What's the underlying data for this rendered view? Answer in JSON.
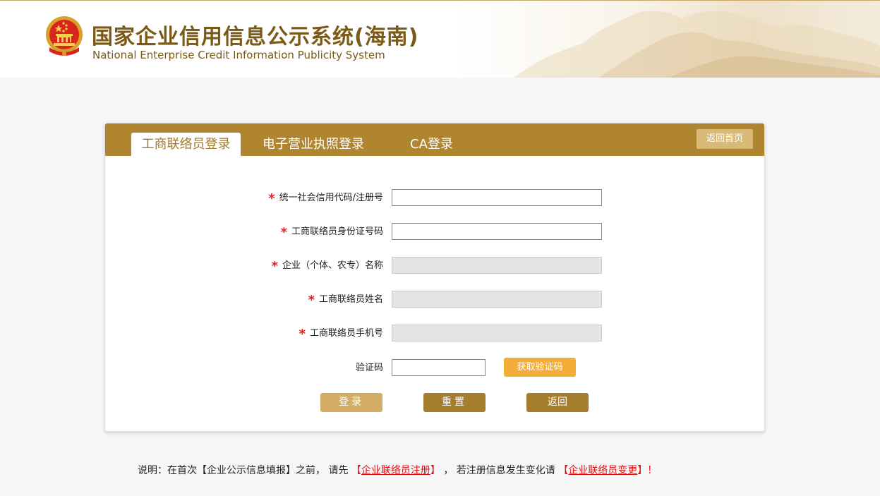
{
  "header": {
    "title_cn": "国家企业信用信息公示系统(海南)",
    "title_en": "National Enterprise Credit Information Publicity System"
  },
  "tabs": [
    {
      "label": "工商联络员登录",
      "active": true
    },
    {
      "label": "电子营业执照登录",
      "active": false
    },
    {
      "label": "CA登录",
      "active": false
    }
  ],
  "home_button": "返回首页",
  "form": {
    "credit_code": {
      "label": "统一社会信用代码/注册号",
      "required": true,
      "value": ""
    },
    "liaison_id": {
      "label": "工商联络员身份证号码",
      "required": true,
      "value": ""
    },
    "enterprise_name": {
      "label": "企业（个体、农专）名称",
      "required": true,
      "value": ""
    },
    "liaison_name": {
      "label": "工商联络员姓名",
      "required": true,
      "value": ""
    },
    "liaison_phone": {
      "label": "工商联络员手机号",
      "required": true,
      "value": ""
    },
    "captcha": {
      "label": "验证码",
      "required": false,
      "value": ""
    },
    "required_mark": "*",
    "get_code_button": "获取验证码"
  },
  "buttons": {
    "login": "登录",
    "reset": "重置",
    "back": "返回"
  },
  "notice": {
    "prefix": "说明：在首次【企业公示信息填报】之前， 请先",
    "link1_open": "【",
    "link1": "企业联络员注册",
    "link1_close": "】",
    "middle": "， 若注册信息发生变化请",
    "link2_open": "【",
    "link2": "企业联络员变更",
    "link2_close": "】",
    "suffix": "！"
  },
  "colors": {
    "brand_gold": "#af8530",
    "accent_orange": "#f5ad3a",
    "required_red": "#e02020",
    "link_red": "#e01010"
  }
}
